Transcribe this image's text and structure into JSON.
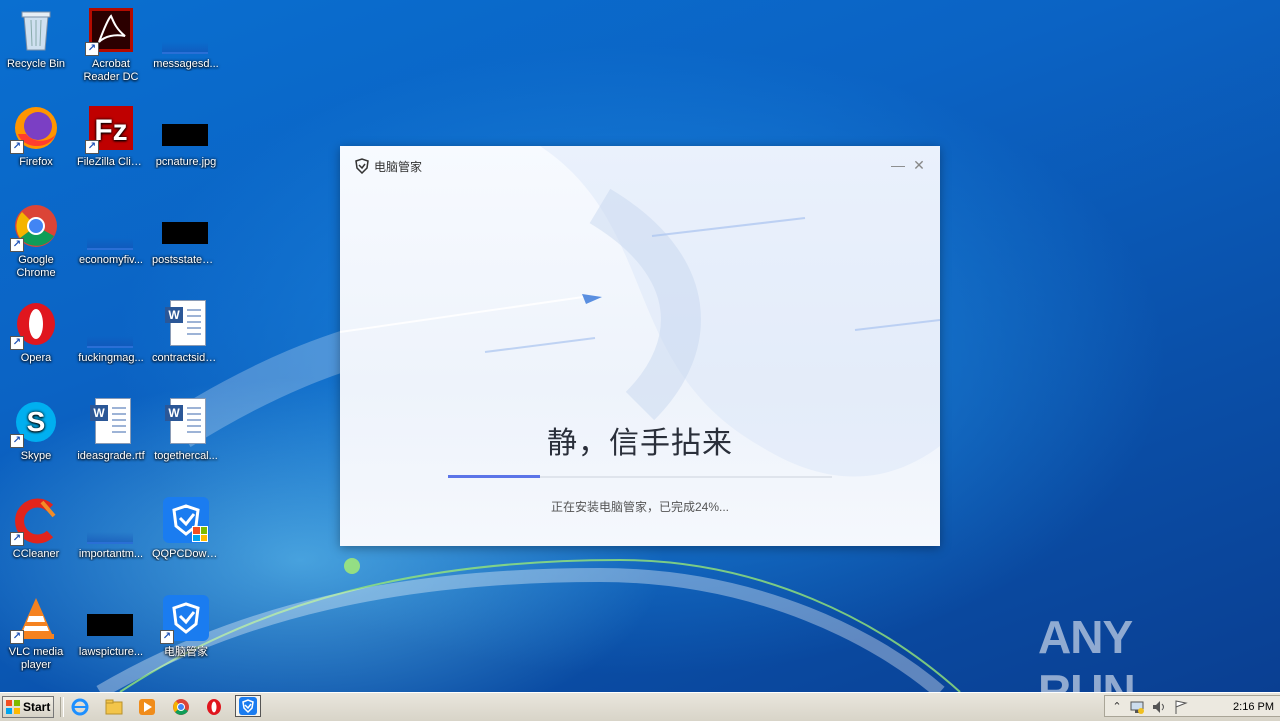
{
  "desktop": {
    "icons": [
      {
        "label": "Recycle Bin",
        "icon": "recycle-bin-icon"
      },
      {
        "label": "Acrobat Reader DC",
        "icon": "acrobat-icon"
      },
      {
        "label": "messagesd...",
        "icon": "file-icon"
      },
      {
        "label": "Firefox",
        "icon": "firefox-icon"
      },
      {
        "label": "FileZilla Client",
        "icon": "filezilla-icon"
      },
      {
        "label": "pcnature.jpg",
        "icon": "image-file-icon"
      },
      {
        "label": "Google Chrome",
        "icon": "chrome-icon"
      },
      {
        "label": "economyfiv...",
        "icon": "file-icon"
      },
      {
        "label": "postsstatem...",
        "icon": "image-file-icon"
      },
      {
        "label": "Opera",
        "icon": "opera-icon"
      },
      {
        "label": "fuckingmag...",
        "icon": "file-icon"
      },
      {
        "label": "contractside...",
        "icon": "word-doc-icon"
      },
      {
        "label": "Skype",
        "icon": "skype-icon"
      },
      {
        "label": "ideasgrade.rtf",
        "icon": "word-doc-icon"
      },
      {
        "label": "togethercal...",
        "icon": "word-doc-icon"
      },
      {
        "label": "CCleaner",
        "icon": "ccleaner-icon"
      },
      {
        "label": "importantm...",
        "icon": "file-icon"
      },
      {
        "label": "QQPCDownl...",
        "icon": "pc-manager-setup-icon"
      },
      {
        "label": "VLC media player",
        "icon": "vlc-icon"
      },
      {
        "label": "lawspicture...",
        "icon": "image-file-icon"
      },
      {
        "label": "电脑管家",
        "icon": "pc-manager-icon"
      }
    ]
  },
  "installer": {
    "title": "电脑管家",
    "slogan": "静，信手拈来",
    "progress": 0.24,
    "status": "正在安装电脑管家，已完成24%...",
    "minimize": "—",
    "close": "✕"
  },
  "taskbar": {
    "start_label": "Start",
    "clock": "2:16 PM",
    "apps": [
      "ie-icon",
      "explorer-icon",
      "media-player-icon",
      "chrome-icon",
      "opera-icon",
      "pc-manager-icon"
    ],
    "tray": [
      "chevron-up-icon",
      "network-icon",
      "volume-icon",
      "flag-icon"
    ]
  },
  "watermark": {
    "text": "ANY RUN"
  },
  "colors": {
    "accent": "#5b74e8",
    "desktop": "#0b63c4"
  }
}
